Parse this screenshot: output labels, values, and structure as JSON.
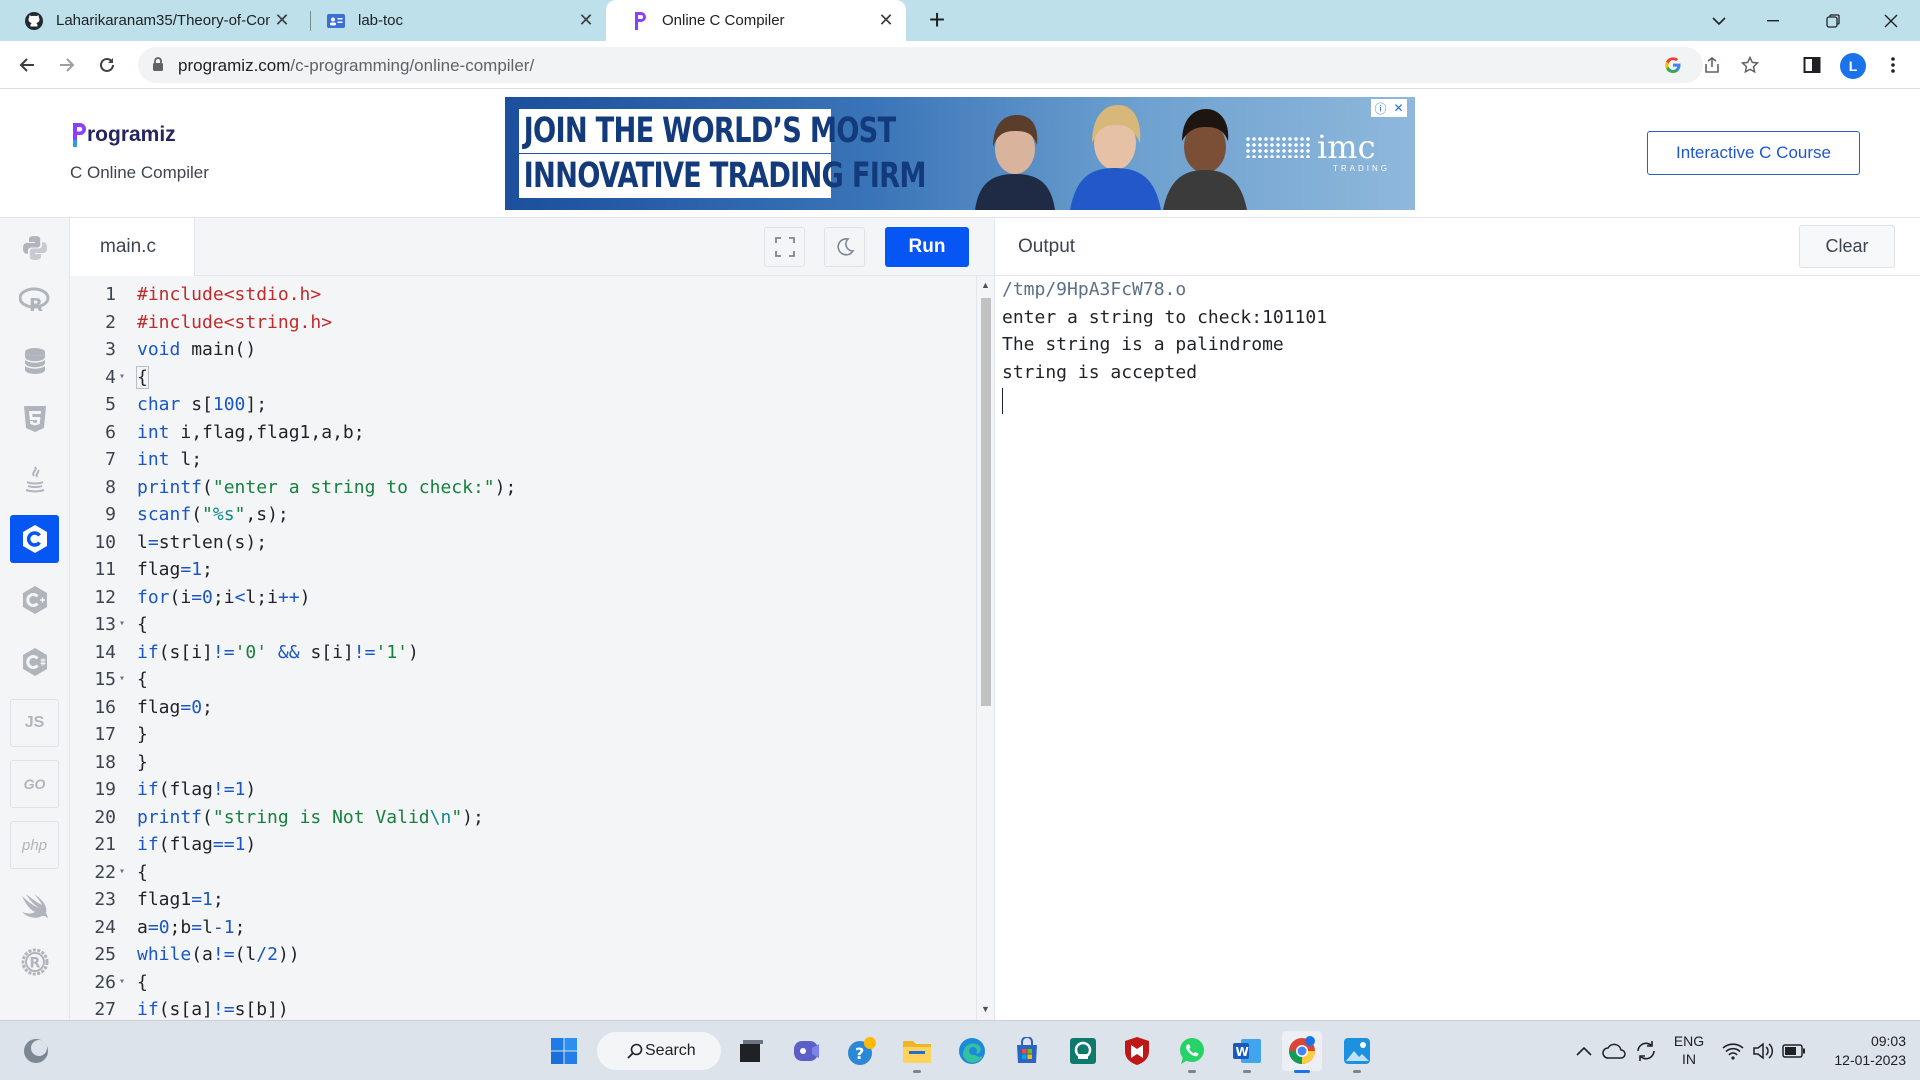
{
  "browser": {
    "tabs": [
      {
        "title": "Laharikaranam35/Theory-of-Com",
        "icon": "github-icon"
      },
      {
        "title": "lab-toc",
        "icon": "doc-icon"
      },
      {
        "title": "Online C Compiler",
        "icon": "programiz-icon"
      }
    ],
    "url_host": "programiz.com",
    "url_path": "/c-programming/online-compiler/",
    "profile_initial": "L"
  },
  "site": {
    "logo_text": "rogramiz",
    "subtitle": "C Online Compiler",
    "ad": {
      "line1": "JOIN THE WORLD’S  MOST",
      "line2": "INNOVATIVE TRADING FIRM",
      "brand": "imc",
      "brand_sub": "TRADING"
    },
    "course_button": "Interactive C Course"
  },
  "languages": [
    {
      "name": "python",
      "label": ""
    },
    {
      "name": "r",
      "label": "R"
    },
    {
      "name": "sql",
      "label": ""
    },
    {
      "name": "html",
      "label": ""
    },
    {
      "name": "java",
      "label": ""
    },
    {
      "name": "c",
      "label": ""
    },
    {
      "name": "cpp",
      "label": ""
    },
    {
      "name": "csharp",
      "label": ""
    },
    {
      "name": "js",
      "label": "JS"
    },
    {
      "name": "go",
      "label": "GO"
    },
    {
      "name": "php",
      "label": "php"
    },
    {
      "name": "swift",
      "label": ""
    },
    {
      "name": "rust",
      "label": "R"
    }
  ],
  "editor": {
    "file_name": "main.c",
    "run_label": "Run",
    "lines": [
      {
        "n": "1",
        "fold": false
      },
      {
        "n": "2",
        "fold": false
      },
      {
        "n": "3",
        "fold": false
      },
      {
        "n": "4",
        "fold": true
      },
      {
        "n": "5",
        "fold": false
      },
      {
        "n": "6",
        "fold": false
      },
      {
        "n": "7",
        "fold": false
      },
      {
        "n": "8",
        "fold": false
      },
      {
        "n": "9",
        "fold": false
      },
      {
        "n": "10",
        "fold": false
      },
      {
        "n": "11",
        "fold": false
      },
      {
        "n": "12",
        "fold": false
      },
      {
        "n": "13",
        "fold": true
      },
      {
        "n": "14",
        "fold": false
      },
      {
        "n": "15",
        "fold": true
      },
      {
        "n": "16",
        "fold": false
      },
      {
        "n": "17",
        "fold": false
      },
      {
        "n": "18",
        "fold": false
      },
      {
        "n": "19",
        "fold": false
      },
      {
        "n": "20",
        "fold": false
      },
      {
        "n": "21",
        "fold": false
      },
      {
        "n": "22",
        "fold": true
      },
      {
        "n": "23",
        "fold": false
      },
      {
        "n": "24",
        "fold": false
      },
      {
        "n": "25",
        "fold": false
      },
      {
        "n": "26",
        "fold": true
      },
      {
        "n": "27",
        "fold": false
      }
    ],
    "code": [
      [
        [
          "inc",
          "#include<stdio.h>"
        ]
      ],
      [
        [
          "inc",
          "#include<string.h>"
        ]
      ],
      [
        [
          "kw",
          "void"
        ],
        [
          "",
          " main()"
        ]
      ],
      [
        [
          "brace",
          "{"
        ]
      ],
      [
        [
          "kw",
          "char"
        ],
        [
          "",
          " s["
        ],
        [
          "num",
          "100"
        ],
        [
          "",
          "];"
        ]
      ],
      [
        [
          "kw",
          "int"
        ],
        [
          "",
          " i,flag,flag1,a,b;"
        ]
      ],
      [
        [
          "kw",
          "int"
        ],
        [
          "",
          " l;"
        ]
      ],
      [
        [
          "kw",
          "printf"
        ],
        [
          "",
          "("
        ],
        [
          "str",
          "\"enter a string to check:\""
        ],
        [
          "",
          ");"
        ]
      ],
      [
        [
          "kw",
          "scanf"
        ],
        [
          "",
          "("
        ],
        [
          "str",
          "\""
        ],
        [
          "esc",
          "%s"
        ],
        [
          "str",
          "\""
        ],
        [
          "",
          ",s);"
        ]
      ],
      [
        [
          "",
          "l"
        ],
        [
          "kw",
          "="
        ],
        [
          "",
          "strlen(s);"
        ]
      ],
      [
        [
          "",
          "flag"
        ],
        [
          "kw",
          "="
        ],
        [
          "num",
          "1"
        ],
        [
          "",
          ";"
        ]
      ],
      [
        [
          "kw",
          "for"
        ],
        [
          "",
          "(i"
        ],
        [
          "kw",
          "="
        ],
        [
          "num",
          "0"
        ],
        [
          "",
          ";i"
        ],
        [
          "kw",
          "<"
        ],
        [
          "",
          "l;i"
        ],
        [
          "kw",
          "++"
        ],
        [
          "",
          ")"
        ]
      ],
      [
        [
          "",
          "{"
        ]
      ],
      [
        [
          "kw",
          "if"
        ],
        [
          "",
          "(s[i]"
        ],
        [
          "kw",
          "!="
        ],
        [
          "str",
          "'0'"
        ],
        [
          "",
          " "
        ],
        [
          "kw",
          "&&"
        ],
        [
          "",
          " s[i]"
        ],
        [
          "kw",
          "!="
        ],
        [
          "str",
          "'1'"
        ],
        [
          "",
          ")"
        ]
      ],
      [
        [
          "",
          "{"
        ]
      ],
      [
        [
          "",
          "flag"
        ],
        [
          "kw",
          "="
        ],
        [
          "num",
          "0"
        ],
        [
          "",
          ";"
        ]
      ],
      [
        [
          "",
          "}"
        ]
      ],
      [
        [
          "",
          "}"
        ]
      ],
      [
        [
          "kw",
          "if"
        ],
        [
          "",
          "(flag"
        ],
        [
          "kw",
          "!="
        ],
        [
          "num",
          "1"
        ],
        [
          "",
          ")"
        ]
      ],
      [
        [
          "kw",
          "printf"
        ],
        [
          "",
          "("
        ],
        [
          "str",
          "\"string is Not Valid"
        ],
        [
          "esc",
          "\\n"
        ],
        [
          "str",
          "\""
        ],
        [
          "",
          ");"
        ]
      ],
      [
        [
          "kw",
          "if"
        ],
        [
          "",
          "(flag"
        ],
        [
          "kw",
          "=="
        ],
        [
          "num",
          "1"
        ],
        [
          "",
          ")"
        ]
      ],
      [
        [
          "",
          "{"
        ]
      ],
      [
        [
          "",
          "flag1"
        ],
        [
          "kw",
          "="
        ],
        [
          "num",
          "1"
        ],
        [
          "",
          ";"
        ]
      ],
      [
        [
          "",
          "a"
        ],
        [
          "kw",
          "="
        ],
        [
          "num",
          "0"
        ],
        [
          "",
          ";b"
        ],
        [
          "kw",
          "="
        ],
        [
          "",
          "l"
        ],
        [
          "kw",
          "-"
        ],
        [
          "num",
          "1"
        ],
        [
          "",
          ";"
        ]
      ],
      [
        [
          "kw",
          "while"
        ],
        [
          "",
          "(a"
        ],
        [
          "kw",
          "!="
        ],
        [
          "",
          "(l"
        ],
        [
          "kw",
          "/"
        ],
        [
          "num",
          "2"
        ],
        [
          "",
          "))"
        ]
      ],
      [
        [
          "",
          "{"
        ]
      ],
      [
        [
          "kw",
          "if"
        ],
        [
          "",
          "(s[a]"
        ],
        [
          "kw",
          "!="
        ],
        [
          "",
          "s[b])"
        ]
      ]
    ]
  },
  "output": {
    "title": "Output",
    "clear_label": "Clear",
    "lines": [
      "/tmp/9HpA3FcW78.o",
      "enter a string to check:101101",
      "The string is a palindrome",
      "string is accepted"
    ]
  },
  "taskbar": {
    "search_label": "Search",
    "apps": [
      "start-icon",
      "task-view-icon",
      "teams-icon",
      "help-icon",
      "file-explorer-icon",
      "edge-icon",
      "store-icon",
      "app-icon",
      "mcafee-icon",
      "whatsapp-icon",
      "word-icon",
      "chrome-icon",
      "photos-icon"
    ],
    "language_line1": "ENG",
    "language_line2": "IN",
    "time": "09:03",
    "date": "12-01-2023"
  },
  "colors": {
    "accent": "#0556f3",
    "tabstrip": "#bde0eb",
    "keyword": "#1a56c6",
    "string": "#16813d",
    "include": "#c22a2a"
  }
}
